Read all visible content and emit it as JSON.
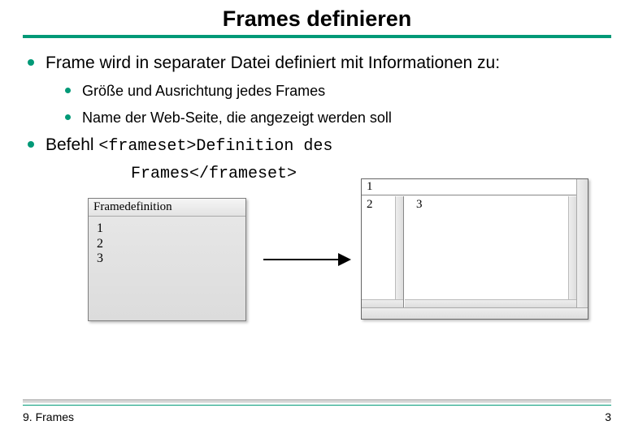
{
  "title": "Frames definieren",
  "bullet1": "Frame wird in separater Datei definiert mit Informationen zu:",
  "sub1": "Größe und Ausrichtung jedes Frames",
  "sub2": "Name der Web-Seite, die angezeigt werden soll",
  "bullet2_prefix": "Befehl ",
  "bullet2_code1": "<frameset>Definition des",
  "bullet2_code2": "Frames</frameset>",
  "diagram": {
    "left_title": "Framedefinition",
    "left_lines": [
      "1",
      "2",
      "3"
    ],
    "right_frame1": "1",
    "right_frame2": "2",
    "right_frame3": "3"
  },
  "footer_left": "9. Frames",
  "footer_right": "3"
}
